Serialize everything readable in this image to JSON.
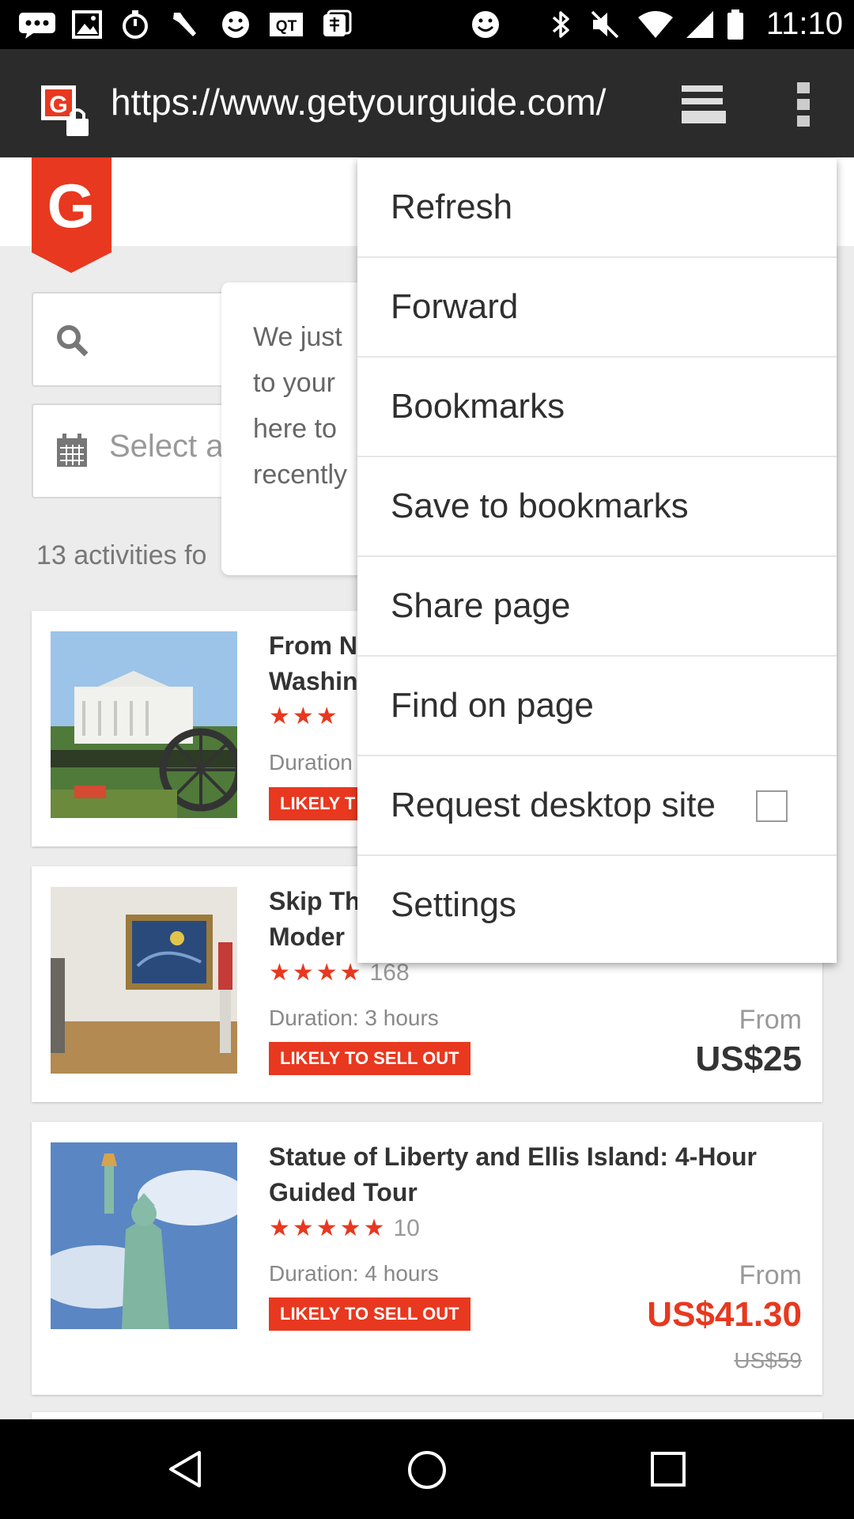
{
  "status_bar": {
    "time": "11:10",
    "left_icons": [
      "messages-icon",
      "gallery-icon",
      "stopwatch-icon",
      "wrench-icon",
      "smiley-icon",
      "qt-icon",
      "mahjong-icon",
      "smiley-icon"
    ],
    "right_icons": [
      "bluetooth-icon",
      "mute-icon",
      "wifi-icon",
      "signal-icon",
      "battery-icon"
    ]
  },
  "browser": {
    "url": "https://www.getyourguide.com/",
    "tabs_icon": "tabs-icon",
    "overflow_icon": "overflow-menu-icon"
  },
  "site": {
    "logo_letter": "G",
    "date_placeholder": "Select a",
    "activities_count_text": "13 activities fo",
    "tooltip_lines": "We just\nto your \nhere to \nrecently"
  },
  "activities": [
    {
      "title": "From N\nWashin",
      "stars": "★★★",
      "rating_count": "",
      "duration": "Duration",
      "badge": "LIKELY T",
      "from": "",
      "price": "",
      "old_price": ""
    },
    {
      "title": "Skip Th\nModer",
      "stars": "★★★★",
      "rating_count": "168",
      "duration": "Duration: 3 hours",
      "badge": "LIKELY TO SELL OUT",
      "from": "From",
      "price": "US$25",
      "old_price": ""
    },
    {
      "title": "Statue of Liberty and Ellis Island: 4-Hour Guided Tour",
      "stars": "★★★★★",
      "rating_count": "10",
      "duration": "Duration: 4 hours",
      "badge": "LIKELY TO SELL OUT",
      "from": "From",
      "price": "US$41.30",
      "old_price": "US$59"
    }
  ],
  "menu": {
    "items": [
      {
        "label": "Refresh"
      },
      {
        "label": "Forward"
      },
      {
        "label": "Bookmarks"
      },
      {
        "label": "Save to bookmarks"
      },
      {
        "label": "Share page"
      },
      {
        "label": "Find on page"
      },
      {
        "label": "Request desktop site",
        "checked": false
      },
      {
        "label": "Settings"
      }
    ]
  },
  "nav_bar": {
    "buttons": [
      "back-icon",
      "home-icon",
      "recents-icon"
    ]
  },
  "colors": {
    "brand": "#e8381f",
    "url_bar": "#2b2b2b",
    "menu_bg": "#ffffff"
  }
}
